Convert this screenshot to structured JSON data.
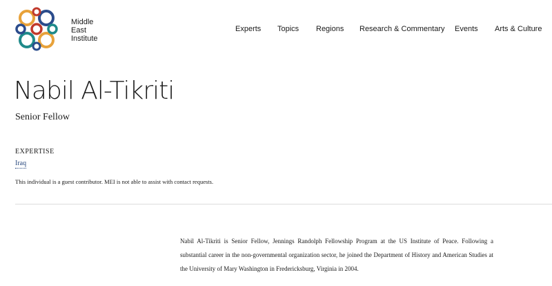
{
  "header": {
    "logo_lines": [
      "Middle",
      "East",
      "Institute"
    ],
    "nav": [
      "Experts",
      "Topics",
      "Regions",
      "Research & Commentary",
      "Events",
      "Arts & Culture"
    ]
  },
  "profile": {
    "name": "Nabil Al-Tikriti",
    "title": "Senior Fellow",
    "expertise_label": "EXPERTISE",
    "expertise_items": [
      "Iraq"
    ],
    "note": "This individual is a guest contributor. MEI is not able to assist with contact requests.",
    "bio": "Nabil Al-Tikriti is Senior Fellow, Jennings Randolph Fellowship Program at the US Institute of Peace. Following a substantial career in the non-governmental organization sector, he joined the Department of History and American Studies at the University of Mary Washington in Fredericksburg, Virginia in 2004."
  },
  "colors": {
    "logo_blue": "#2b4c8c",
    "logo_orange": "#e8a23a",
    "logo_teal": "#1f8a8a",
    "logo_red": "#c0392b",
    "link": "#2a4a7f"
  }
}
